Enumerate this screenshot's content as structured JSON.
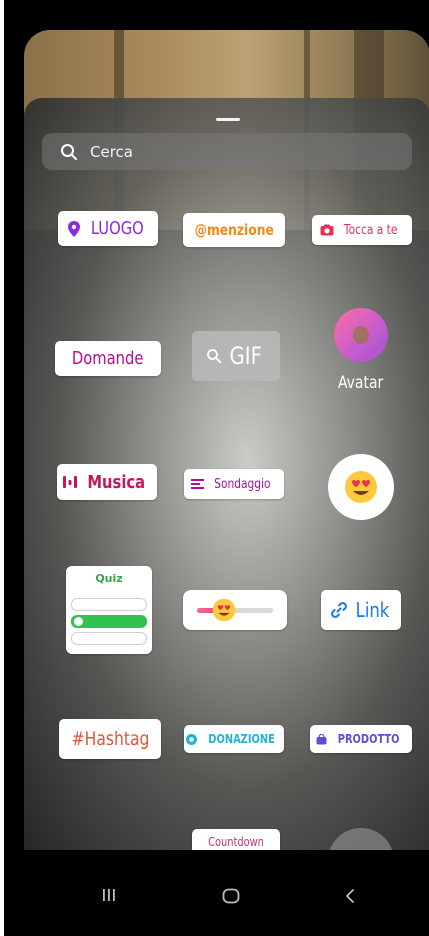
{
  "search": {
    "placeholder": "Cerca"
  },
  "stickers": {
    "luogo": "LUOGO",
    "menzione": "@menzione",
    "tocca_a_te": "Tocca a te",
    "domande": "Domande",
    "gif": "GIF",
    "avatar": "Avatar",
    "musica": "Musica",
    "sondaggio": "Sondaggio",
    "quiz": "Quiz",
    "link": "Link",
    "hashtag": "#Hashtag",
    "donazione": "DONAZIONE",
    "prodotto": "PRODOTTO",
    "countdown": "Countdown"
  },
  "slider": {
    "level": 0.35
  },
  "icons": {
    "search": "search-icon",
    "location": "location-pin-icon",
    "camera": "camera-icon",
    "gif_search": "search-icon",
    "music": "music-bars-icon",
    "poll": "poll-lines-icon",
    "heart_eyes": "heart-eyes-emoji-icon",
    "link": "link-icon",
    "donation": "donation-icon",
    "product": "shopping-bag-icon",
    "nav_recents": "recents-icon",
    "nav_home": "home-icon",
    "nav_back": "back-chevron-icon"
  },
  "colors": {
    "luogo": "#8a2be2",
    "menzione": "#f28a1a",
    "tocca_a_te": "#e8305a",
    "domande": "#b40f8f",
    "musica": "#c2185b",
    "sondaggio": "#b1109d",
    "quiz": "#3aa04a",
    "link": "#1877f2",
    "hashtag": "#e2543a",
    "donazione": "#20b3d8",
    "prodotto": "#5b4fd6"
  }
}
